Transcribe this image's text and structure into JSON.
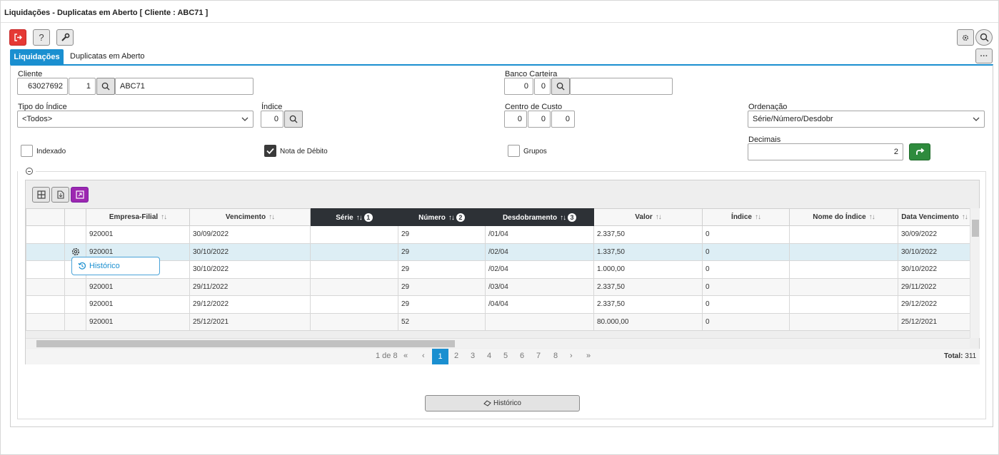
{
  "window": {
    "title": "Liquidações - Duplicatas em Aberto [ Cliente : ABC71 ]"
  },
  "toolbar": {
    "exit_icon": "exit-icon",
    "help_label": "?",
    "tools_icon": "wrench-icon",
    "settings_icon": "gear-icon",
    "search_icon": "search-icon",
    "more_label": "···"
  },
  "tabs": [
    {
      "label": "Liquidações",
      "active": true
    },
    {
      "label": "Duplicatas em Aberto",
      "active": false
    }
  ],
  "form": {
    "cliente": {
      "label": "Cliente",
      "code": "63027692",
      "seq": "1",
      "name": "ABC71"
    },
    "banco_carteira": {
      "label": "Banco Carteira",
      "v1": "0",
      "v2": "0",
      "desc": ""
    },
    "tipo_indice": {
      "label": "Tipo do Índice",
      "value": "<Todos>"
    },
    "indice": {
      "label": "Índice",
      "value": "0"
    },
    "centro_custo": {
      "label": "Centro de Custo",
      "v1": "0",
      "v2": "0",
      "v3": "0"
    },
    "ordenacao": {
      "label": "Ordenação",
      "value": "Série/Número/Desdobr"
    },
    "indexado": {
      "label": "Indexado",
      "checked": false
    },
    "nota_debito": {
      "label": "Nota de Débito",
      "checked": true
    },
    "grupos": {
      "label": "Grupos",
      "checked": false
    },
    "decimais": {
      "label": "Decimais",
      "value": "2"
    }
  },
  "grid": {
    "columns": [
      "",
      "",
      "Empresa-Filial",
      "Vencimento",
      "Série",
      "Número",
      "Desdobramento",
      "Valor",
      "Índice",
      "Nome do Índice",
      "Data Vencimento"
    ],
    "sort_badges": {
      "serie": "1",
      "numero": "2",
      "desdobramento": "3"
    },
    "rows": [
      {
        "empresa": "920001",
        "vencimento": "30/09/2022",
        "serie": "",
        "numero": "29",
        "desdobramento": "/01/04",
        "valor": "2.337,50",
        "indice": "0",
        "nome_indice": "",
        "data_vencimento": "30/09/2022"
      },
      {
        "empresa": "920001",
        "vencimento": "30/10/2022",
        "serie": "",
        "numero": "29",
        "desdobramento": "/02/04",
        "valor": "1.337,50",
        "indice": "0",
        "nome_indice": "",
        "data_vencimento": "30/10/2022"
      },
      {
        "empresa": "",
        "vencimento": "30/10/2022",
        "serie": "",
        "numero": "29",
        "desdobramento": "/02/04",
        "valor": "1.000,00",
        "indice": "0",
        "nome_indice": "",
        "data_vencimento": "30/10/2022"
      },
      {
        "empresa": "920001",
        "vencimento": "29/11/2022",
        "serie": "",
        "numero": "29",
        "desdobramento": "/03/04",
        "valor": "2.337,50",
        "indice": "0",
        "nome_indice": "",
        "data_vencimento": "29/11/2022"
      },
      {
        "empresa": "920001",
        "vencimento": "29/12/2022",
        "serie": "",
        "numero": "29",
        "desdobramento": "/04/04",
        "valor": "2.337,50",
        "indice": "0",
        "nome_indice": "",
        "data_vencimento": "29/12/2022"
      },
      {
        "empresa": "920001",
        "vencimento": "25/12/2021",
        "serie": "",
        "numero": "52",
        "desdobramento": "",
        "valor": "80.000,00",
        "indice": "0",
        "nome_indice": "",
        "data_vencimento": "25/12/2021"
      }
    ],
    "context_menu": {
      "label": "Histórico"
    }
  },
  "pager": {
    "info": "1 de 8",
    "first": "«",
    "prev": "‹",
    "next": "›",
    "last": "»",
    "pages": [
      "1",
      "2",
      "3",
      "4",
      "5",
      "6",
      "7",
      "8"
    ],
    "total_label": "Total:",
    "total_value": "311"
  },
  "footer": {
    "historico_label": "Histórico"
  }
}
